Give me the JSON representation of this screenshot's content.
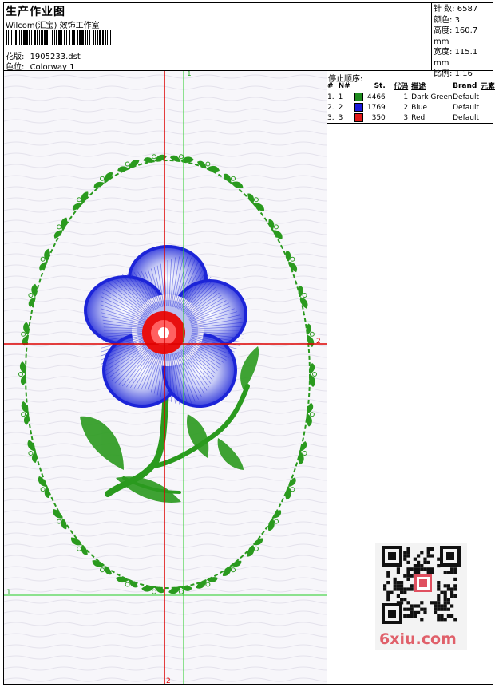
{
  "header": {
    "title": "生产作业图",
    "studio": "Wilcom(汇宝) 效饰工作室",
    "pattern_label": "花版:",
    "pattern_value": "1905233.dst",
    "colorway_label": "色位:",
    "colorway_value": "Colorway 1"
  },
  "stats": [
    {
      "label": "针 数:",
      "value": "6587"
    },
    {
      "label": "颜色:",
      "value": "3"
    },
    {
      "label": "高度:",
      "value": "160.7 mm"
    },
    {
      "label": "宽度:",
      "value": "115.1 mm"
    },
    {
      "label": "比例:",
      "value": "1.16"
    }
  ],
  "sequence": {
    "title": "停止顺序:",
    "headers": [
      "#",
      "N#",
      "St.",
      "代码",
      "描述",
      "Brand",
      "元素"
    ],
    "rows": [
      {
        "idx": "1.",
        "n": "1",
        "color": "#1e8c1e",
        "st": "4466",
        "code": "1",
        "desc": "Dark Green",
        "brand": "Default"
      },
      {
        "idx": "2.",
        "n": "2",
        "color": "#1a1adc",
        "st": "1769",
        "code": "2",
        "desc": "Blue",
        "brand": "Default"
      },
      {
        "idx": "3.",
        "n": "3",
        "color": "#e01818",
        "st": "350",
        "code": "3",
        "desc": "Red",
        "brand": "Default"
      }
    ]
  },
  "guides": {
    "green_vertical_label": "1",
    "green_horizontal_label": "1",
    "red_horizontal_label": "2",
    "red_vertical_label": "2"
  },
  "colors": {
    "green": "#2a9a1e",
    "blue": "#1c24d8",
    "red": "#e81010",
    "guide_green": "#22cc22",
    "guide_red": "#dd0000"
  },
  "watermark": "6xiu.com"
}
